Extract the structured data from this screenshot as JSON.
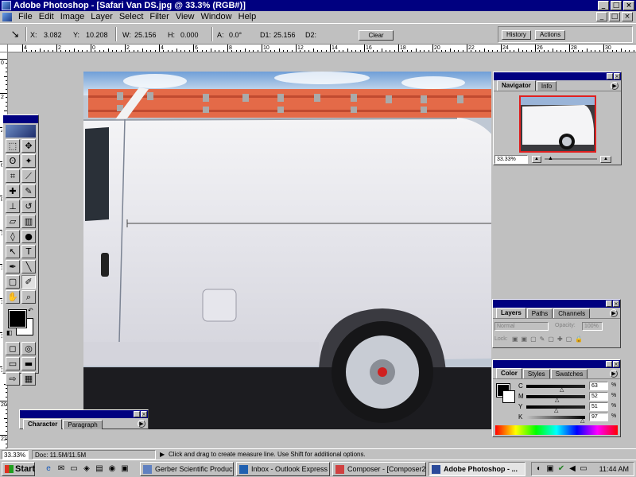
{
  "window": {
    "title": "Adobe Photoshop - [Safari Van DS.jpg @ 33.3% (RGB#)]",
    "min": "_",
    "max": "□",
    "close": "×"
  },
  "menu": [
    "File",
    "Edit",
    "Image",
    "Layer",
    "Select",
    "Filter",
    "View",
    "Window",
    "Help"
  ],
  "options": {
    "x_label": "X:",
    "x_value": "3.082",
    "y_label": "Y:",
    "y_value": "10.208",
    "w_label": "W:",
    "w_value": "25.156",
    "h_label": "H:",
    "h_value": "0.000",
    "a_label": "A:",
    "a_value": "0.0°",
    "d1_label": "D1:",
    "d1_value": "25.156",
    "d2_label": "D2:",
    "d2_value": "",
    "clear": "Clear"
  },
  "palette_well": {
    "tab1": "History",
    "tab2": "Actions"
  },
  "ruler_top": [
    "4",
    "2",
    "0",
    "2",
    "4",
    "6",
    "8",
    "10",
    "12",
    "14",
    "16",
    "18",
    "20",
    "22",
    "24",
    "26",
    "28",
    "30",
    "32"
  ],
  "ruler_left": [
    "0",
    "2",
    "4",
    "6",
    "8",
    "10",
    "12",
    "14",
    "16",
    "18",
    "20",
    "22"
  ],
  "navigator": {
    "tab1": "Navigator",
    "tab2": "Info",
    "zoom": "33.33%"
  },
  "layers": {
    "tab1": "Layers",
    "tab2": "Paths",
    "tab3": "Channels",
    "blend_mode": "Normal",
    "opacity_label": "Opacity:",
    "opacity_value": "100%",
    "lock_label": "Lock:"
  },
  "color": {
    "tab1": "Color",
    "tab2": "Styles",
    "tab3": "Swatches",
    "c_label": "C",
    "c_value": "63",
    "m_label": "M",
    "m_value": "52",
    "y_label": "Y",
    "y_value": "51",
    "k_label": "K",
    "k_value": "97",
    "pct": "%"
  },
  "character": {
    "tab1": "Character",
    "tab2": "Paragraph"
  },
  "status": {
    "zoom": "33.33%",
    "doc": "Doc: 11.5M/11.5M",
    "message": "Click and drag to create measure line.  Use Shift for additional options."
  },
  "taskbar": {
    "start": "Start",
    "tasks": [
      "Gerber Scientific Product...",
      "Inbox - Outlook Express",
      "Composer - [Composer2 *]",
      "Adobe Photoshop - ..."
    ],
    "clock": "11:44 AM"
  },
  "icons": {
    "measure": "↘",
    "menu_arrow": "▶",
    "swap": "↶"
  },
  "colors": {
    "titlebar": "#000080",
    "chrome": "#c0c0c0",
    "nav_frame": "#e02020"
  }
}
